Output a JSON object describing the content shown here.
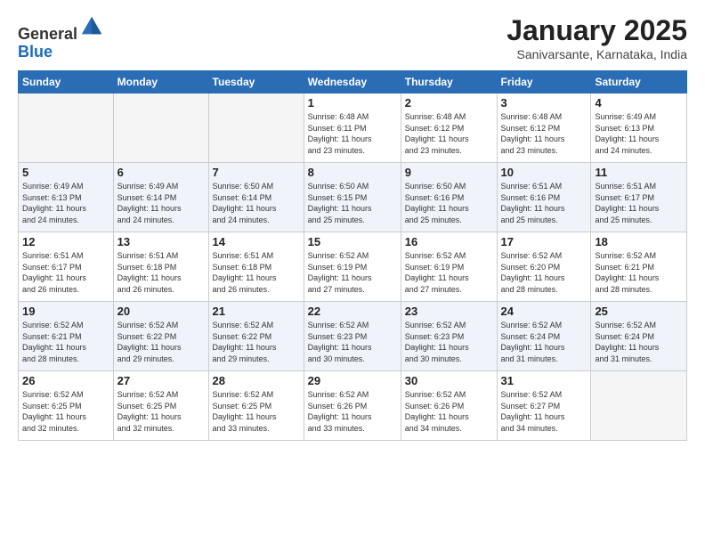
{
  "header": {
    "logo_general": "General",
    "logo_blue": "Blue",
    "month_title": "January 2025",
    "location": "Sanivarsante, Karnataka, India"
  },
  "weekdays": [
    "Sunday",
    "Monday",
    "Tuesday",
    "Wednesday",
    "Thursday",
    "Friday",
    "Saturday"
  ],
  "weeks": [
    [
      {
        "day": "",
        "info": ""
      },
      {
        "day": "",
        "info": ""
      },
      {
        "day": "",
        "info": ""
      },
      {
        "day": "1",
        "info": "Sunrise: 6:48 AM\nSunset: 6:11 PM\nDaylight: 11 hours\nand 23 minutes."
      },
      {
        "day": "2",
        "info": "Sunrise: 6:48 AM\nSunset: 6:12 PM\nDaylight: 11 hours\nand 23 minutes."
      },
      {
        "day": "3",
        "info": "Sunrise: 6:48 AM\nSunset: 6:12 PM\nDaylight: 11 hours\nand 23 minutes."
      },
      {
        "day": "4",
        "info": "Sunrise: 6:49 AM\nSunset: 6:13 PM\nDaylight: 11 hours\nand 24 minutes."
      }
    ],
    [
      {
        "day": "5",
        "info": "Sunrise: 6:49 AM\nSunset: 6:13 PM\nDaylight: 11 hours\nand 24 minutes."
      },
      {
        "day": "6",
        "info": "Sunrise: 6:49 AM\nSunset: 6:14 PM\nDaylight: 11 hours\nand 24 minutes."
      },
      {
        "day": "7",
        "info": "Sunrise: 6:50 AM\nSunset: 6:14 PM\nDaylight: 11 hours\nand 24 minutes."
      },
      {
        "day": "8",
        "info": "Sunrise: 6:50 AM\nSunset: 6:15 PM\nDaylight: 11 hours\nand 25 minutes."
      },
      {
        "day": "9",
        "info": "Sunrise: 6:50 AM\nSunset: 6:16 PM\nDaylight: 11 hours\nand 25 minutes."
      },
      {
        "day": "10",
        "info": "Sunrise: 6:51 AM\nSunset: 6:16 PM\nDaylight: 11 hours\nand 25 minutes."
      },
      {
        "day": "11",
        "info": "Sunrise: 6:51 AM\nSunset: 6:17 PM\nDaylight: 11 hours\nand 25 minutes."
      }
    ],
    [
      {
        "day": "12",
        "info": "Sunrise: 6:51 AM\nSunset: 6:17 PM\nDaylight: 11 hours\nand 26 minutes."
      },
      {
        "day": "13",
        "info": "Sunrise: 6:51 AM\nSunset: 6:18 PM\nDaylight: 11 hours\nand 26 minutes."
      },
      {
        "day": "14",
        "info": "Sunrise: 6:51 AM\nSunset: 6:18 PM\nDaylight: 11 hours\nand 26 minutes."
      },
      {
        "day": "15",
        "info": "Sunrise: 6:52 AM\nSunset: 6:19 PM\nDaylight: 11 hours\nand 27 minutes."
      },
      {
        "day": "16",
        "info": "Sunrise: 6:52 AM\nSunset: 6:19 PM\nDaylight: 11 hours\nand 27 minutes."
      },
      {
        "day": "17",
        "info": "Sunrise: 6:52 AM\nSunset: 6:20 PM\nDaylight: 11 hours\nand 28 minutes."
      },
      {
        "day": "18",
        "info": "Sunrise: 6:52 AM\nSunset: 6:21 PM\nDaylight: 11 hours\nand 28 minutes."
      }
    ],
    [
      {
        "day": "19",
        "info": "Sunrise: 6:52 AM\nSunset: 6:21 PM\nDaylight: 11 hours\nand 28 minutes."
      },
      {
        "day": "20",
        "info": "Sunrise: 6:52 AM\nSunset: 6:22 PM\nDaylight: 11 hours\nand 29 minutes."
      },
      {
        "day": "21",
        "info": "Sunrise: 6:52 AM\nSunset: 6:22 PM\nDaylight: 11 hours\nand 29 minutes."
      },
      {
        "day": "22",
        "info": "Sunrise: 6:52 AM\nSunset: 6:23 PM\nDaylight: 11 hours\nand 30 minutes."
      },
      {
        "day": "23",
        "info": "Sunrise: 6:52 AM\nSunset: 6:23 PM\nDaylight: 11 hours\nand 30 minutes."
      },
      {
        "day": "24",
        "info": "Sunrise: 6:52 AM\nSunset: 6:24 PM\nDaylight: 11 hours\nand 31 minutes."
      },
      {
        "day": "25",
        "info": "Sunrise: 6:52 AM\nSunset: 6:24 PM\nDaylight: 11 hours\nand 31 minutes."
      }
    ],
    [
      {
        "day": "26",
        "info": "Sunrise: 6:52 AM\nSunset: 6:25 PM\nDaylight: 11 hours\nand 32 minutes."
      },
      {
        "day": "27",
        "info": "Sunrise: 6:52 AM\nSunset: 6:25 PM\nDaylight: 11 hours\nand 32 minutes."
      },
      {
        "day": "28",
        "info": "Sunrise: 6:52 AM\nSunset: 6:25 PM\nDaylight: 11 hours\nand 33 minutes."
      },
      {
        "day": "29",
        "info": "Sunrise: 6:52 AM\nSunset: 6:26 PM\nDaylight: 11 hours\nand 33 minutes."
      },
      {
        "day": "30",
        "info": "Sunrise: 6:52 AM\nSunset: 6:26 PM\nDaylight: 11 hours\nand 34 minutes."
      },
      {
        "day": "31",
        "info": "Sunrise: 6:52 AM\nSunset: 6:27 PM\nDaylight: 11 hours\nand 34 minutes."
      },
      {
        "day": "",
        "info": ""
      }
    ]
  ]
}
